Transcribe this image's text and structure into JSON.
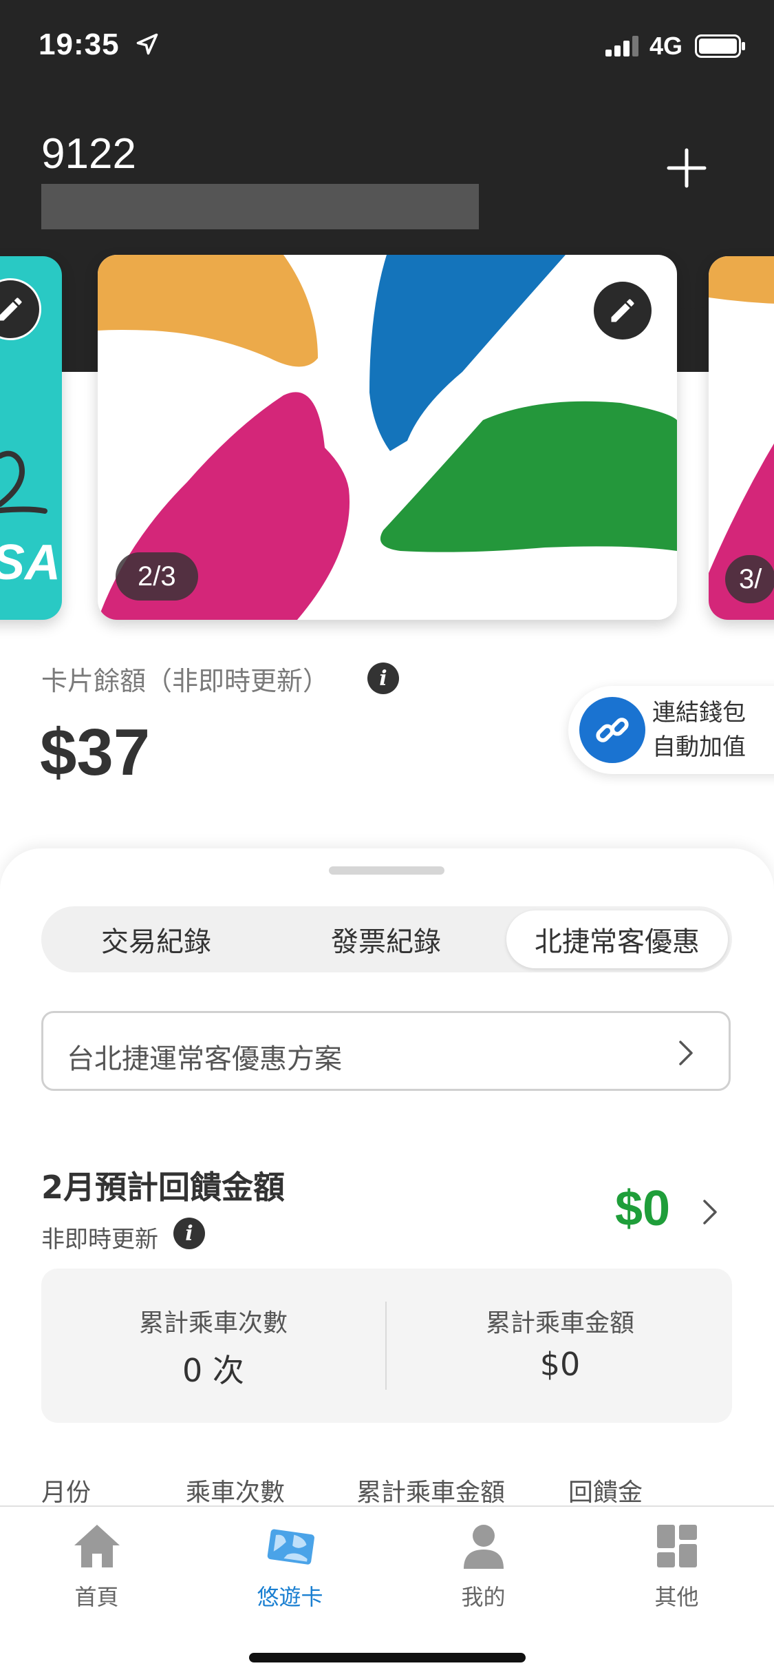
{
  "status_bar": {
    "time": "19:35",
    "network": "4G"
  },
  "header": {
    "account_number": "9122",
    "add_icon": "plus-icon"
  },
  "carousel": {
    "left_card_text": "SA",
    "main_badge": "2/3",
    "right_badge": "3/"
  },
  "balance": {
    "label": "卡片餘額（非即時更新）",
    "value": "$37",
    "link_wallet_line1": "連結錢包",
    "link_wallet_line2": "自動加值"
  },
  "tabs": [
    {
      "label": "交易紀錄",
      "active": false
    },
    {
      "label": "發票紀錄",
      "active": false
    },
    {
      "label": "北捷常客優惠",
      "active": true
    }
  ],
  "program": {
    "label": "台北捷運常客優惠方案"
  },
  "rebate": {
    "title": "2月預計回饋金額",
    "subtitle": "非即時更新",
    "amount": "$0",
    "amount_color": "#1f9e3a"
  },
  "stats": [
    {
      "label": "累計乘車次數",
      "value": "0 次"
    },
    {
      "label": "累計乘車金額",
      "value": "$0"
    }
  ],
  "table_headers": [
    "月份",
    "乘車次數",
    "累計乘車金額",
    "回饋金"
  ],
  "tabbar": [
    {
      "label": "首頁",
      "icon": "home-icon"
    },
    {
      "label": "悠遊卡",
      "icon": "card-icon",
      "active": true
    },
    {
      "label": "我的",
      "icon": "person-icon"
    },
    {
      "label": "其他",
      "icon": "grid-icon"
    }
  ],
  "colors": {
    "accent": "#1a7fd1",
    "header_bg": "#252525"
  }
}
